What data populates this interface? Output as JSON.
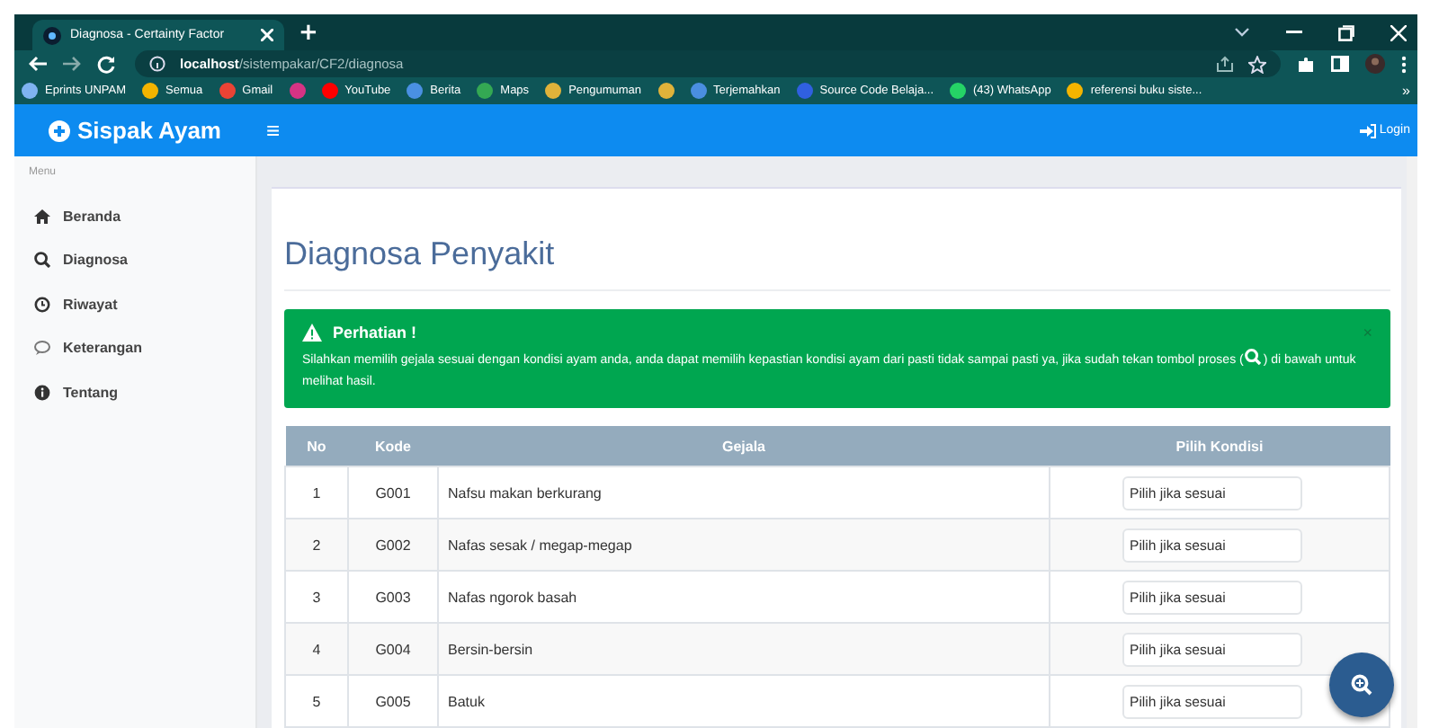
{
  "browser": {
    "tab_title": "Diagnosa - Certainty Factor",
    "new_tab": "+",
    "url_host": "localhost",
    "url_path": "/sistempakar/CF2/diagnosa",
    "bookmarks": [
      {
        "kind": "link",
        "label": "Eprints UNPAM"
      },
      {
        "kind": "link",
        "label": "Semua"
      },
      {
        "kind": "link",
        "label": "Gmail"
      },
      {
        "kind": "icon"
      },
      {
        "kind": "link",
        "label": "YouTube"
      },
      {
        "kind": "link",
        "label": "Berita"
      },
      {
        "kind": "link",
        "label": "Maps"
      },
      {
        "kind": "link",
        "label": "Pengumuman"
      },
      {
        "kind": "icon"
      },
      {
        "kind": "link",
        "label": "Terjemahkan"
      },
      {
        "kind": "link",
        "label": "Source Code Belaja..."
      },
      {
        "kind": "link",
        "label": "(43) WhatsApp"
      },
      {
        "kind": "link",
        "label": "referensi buku siste..."
      }
    ],
    "more": "»"
  },
  "navbar": {
    "brand": "Sispak Ayam",
    "menu_toggle": "≡",
    "login": "Login"
  },
  "sidebar": {
    "heading": "Menu",
    "items": [
      {
        "label": "Beranda",
        "selected": false
      },
      {
        "label": "Diagnosa",
        "selected": false
      },
      {
        "label": "Riwayat",
        "selected": false
      },
      {
        "label": "Keterangan",
        "selected": false
      },
      {
        "label": "Tentang",
        "selected": false
      }
    ]
  },
  "page": {
    "title": "Diagnosa Penyakit",
    "alert": {
      "title": "Perhatian !",
      "close": "×",
      "text_before": "Silahkan memilih gejala sesuai dengan kondisi ayam anda, anda dapat memilih kepastian kondisi ayam dari pasti tidak sampai pasti ya, jika sudah tekan tombol proses (",
      "text_after": ") di bawah untuk melihat hasil."
    },
    "table": {
      "columns": [
        "No",
        "Kode",
        "Gejala",
        "Pilih Kondisi"
      ],
      "rows": [
        {
          "no": "1",
          "kode": "G001",
          "gejala": "Nafsu makan berkurang",
          "kondisi": "Pilih jika sesuai"
        },
        {
          "no": "2",
          "kode": "G002",
          "gejala": "Nafas sesak / megap-megap",
          "kondisi": "Pilih jika sesuai"
        },
        {
          "no": "3",
          "kode": "G003",
          "gejala": "Nafas ngorok basah",
          "kondisi": "Pilih jika sesuai"
        },
        {
          "no": "4",
          "kode": "G004",
          "gejala": "Bersin-bersin",
          "kondisi": "Pilih jika sesuai"
        },
        {
          "no": "5",
          "kode": "G005",
          "gejala": "Batuk",
          "kondisi": "Pilih jika sesuai"
        }
      ]
    }
  }
}
